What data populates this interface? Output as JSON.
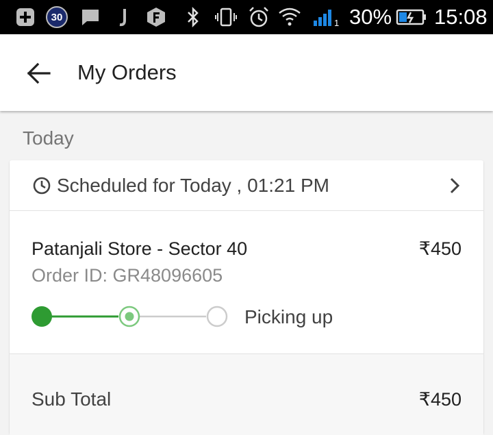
{
  "status_bar": {
    "battery_percent": "30%",
    "time": "15:08",
    "notification_count": "30",
    "sim_indicator": "1",
    "icons": [
      "add-box-icon",
      "badge-30-icon",
      "message-icon",
      "j-app-icon",
      "f-app-icon",
      "bluetooth-icon",
      "vibrate-icon",
      "alarm-icon",
      "wifi-icon",
      "signal-icon",
      "battery-charging-icon"
    ]
  },
  "app_bar": {
    "title": "My Orders",
    "back_icon": "arrow-back-icon"
  },
  "section": {
    "label": "Today"
  },
  "order": {
    "schedule_text": "Scheduled for Today , 01:21 PM",
    "store_name": "Patanjali Store - Sector 40",
    "price": "₹450",
    "order_id": "Order ID: GR48096605",
    "status_text": "Picking up",
    "progress_steps_completed": 1,
    "progress_steps_total": 3,
    "subtotal_label": "Sub Total",
    "subtotal_value": "₹450"
  },
  "colors": {
    "accent_green": "#2e9b32",
    "current_step_green": "#7cc97e",
    "pending_gray": "#cccccc"
  }
}
